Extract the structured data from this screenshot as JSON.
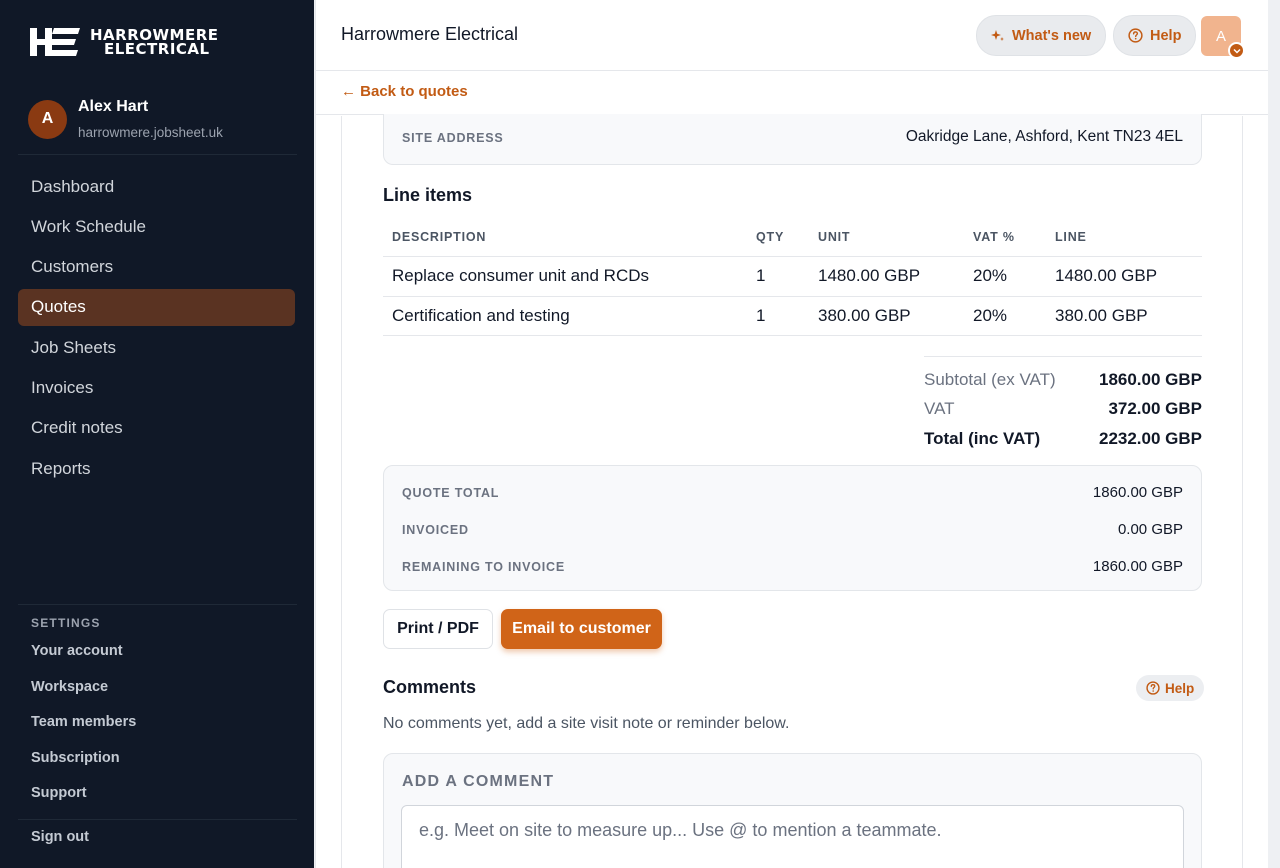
{
  "brand": {
    "logo_line1": "HARROWMERE",
    "logo_line2": "ELECTRICAL",
    "accent": "#c25b14"
  },
  "user": {
    "initial": "A",
    "name": "Alex Hart",
    "domain": "harrowmere.jobsheet.uk"
  },
  "nav": [
    {
      "label": "Dashboard"
    },
    {
      "label": "Work Schedule"
    },
    {
      "label": "Customers"
    },
    {
      "label": "Quotes",
      "active": true
    },
    {
      "label": "Job Sheets"
    },
    {
      "label": "Invoices"
    },
    {
      "label": "Credit notes"
    },
    {
      "label": "Reports"
    }
  ],
  "settings": {
    "heading": "SETTINGS",
    "items": [
      "Your account",
      "Workspace",
      "Team members",
      "Subscription",
      "Support"
    ],
    "sign_out": "Sign out"
  },
  "topbar": {
    "title": "Harrowmere Electrical",
    "whats_new": "What's new",
    "help": "Help",
    "avatar_initial": "A"
  },
  "back_link": "← Back to quotes",
  "site_address": {
    "label": "SITE ADDRESS",
    "value": "Oakridge Lane, Ashford, Kent TN23 4EL"
  },
  "line_items": {
    "heading": "Line items",
    "columns": [
      "DESCRIPTION",
      "QTY",
      "UNIT",
      "VAT %",
      "LINE"
    ],
    "rows": [
      [
        "Replace consumer unit and RCDs",
        "1",
        "1480.00 GBP",
        "20%",
        "1480.00 GBP"
      ],
      [
        "Certification and testing",
        "1",
        "380.00 GBP",
        "20%",
        "380.00 GBP"
      ]
    ]
  },
  "totals": {
    "subtotal_label": "Subtotal (ex VAT)",
    "subtotal": "1860.00 GBP",
    "vat_label": "VAT",
    "vat": "372.00 GBP",
    "total_label": "Total (inc VAT)",
    "total": "2232.00 GBP"
  },
  "summary": {
    "quote_total_label": "QUOTE TOTAL",
    "quote_total": "1860.00 GBP",
    "invoiced_label": "INVOICED",
    "invoiced": "0.00 GBP",
    "remaining_label": "REMAINING TO INVOICE",
    "remaining": "1860.00 GBP"
  },
  "actions": {
    "print": "Print / PDF",
    "email": "Email to customer"
  },
  "comments": {
    "heading": "Comments",
    "help": "Help",
    "empty": "No comments yet, add a site visit note or reminder below.",
    "add_label": "ADD A COMMENT",
    "placeholder": "e.g. Meet on site to measure up... Use @ to mention a teammate."
  }
}
